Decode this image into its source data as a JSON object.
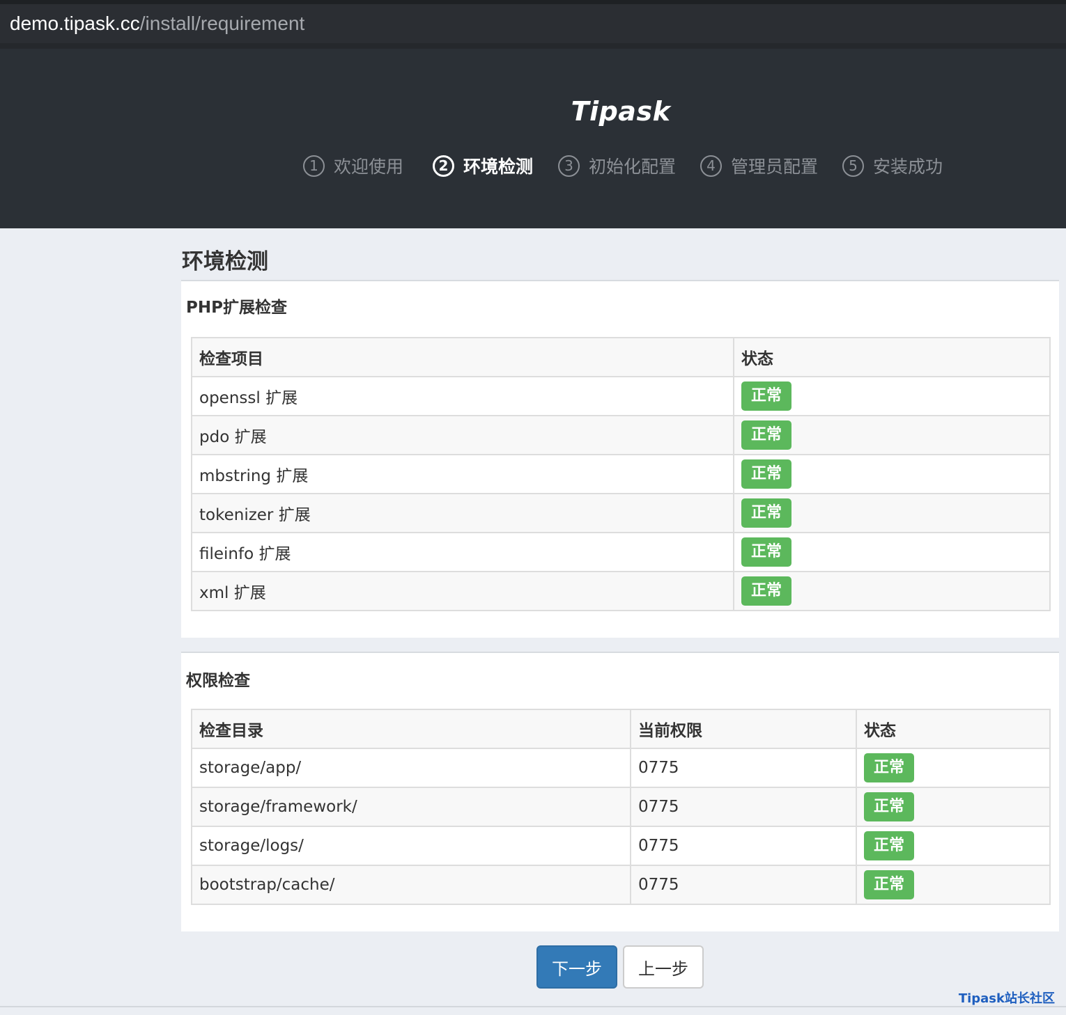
{
  "browser": {
    "url_host": "demo.tipask.cc",
    "url_path": "/install/requirement"
  },
  "header": {
    "brand": "Tipask",
    "steps": [
      {
        "num": "1",
        "label": "欢迎使用",
        "active": false
      },
      {
        "num": "2",
        "label": "环境检测",
        "active": true
      },
      {
        "num": "3",
        "label": "初始化配置",
        "active": false
      },
      {
        "num": "4",
        "label": "管理员配置",
        "active": false
      },
      {
        "num": "5",
        "label": "安装成功",
        "active": false
      }
    ]
  },
  "main": {
    "title": "环境检测",
    "php_section": {
      "title": "PHP扩展检查",
      "columns": [
        "检查项目",
        "状态"
      ],
      "rows": [
        {
          "item": "openssl 扩展",
          "status": "正常"
        },
        {
          "item": "pdo 扩展",
          "status": "正常"
        },
        {
          "item": "mbstring 扩展",
          "status": "正常"
        },
        {
          "item": "tokenizer 扩展",
          "status": "正常"
        },
        {
          "item": "fileinfo 扩展",
          "status": "正常"
        },
        {
          "item": "xml 扩展",
          "status": "正常"
        }
      ]
    },
    "perm_section": {
      "title": "权限检查",
      "columns": [
        "检查目录",
        "当前权限",
        "状态"
      ],
      "rows": [
        {
          "dir": "storage/app/",
          "perm": "0775",
          "status": "正常"
        },
        {
          "dir": "storage/framework/",
          "perm": "0775",
          "status": "正常"
        },
        {
          "dir": "storage/logs/",
          "perm": "0775",
          "status": "正常"
        },
        {
          "dir": "bootstrap/cache/",
          "perm": "0775",
          "status": "正常"
        }
      ]
    }
  },
  "actions": {
    "next_label": "下一步",
    "prev_label": "上一步"
  },
  "watermark": "Tipask站长社区",
  "colors": {
    "header_bg": "#2b3036",
    "page_bg": "#ebeef3",
    "badge_success": "#5cb85c",
    "primary": "#337ab7"
  }
}
